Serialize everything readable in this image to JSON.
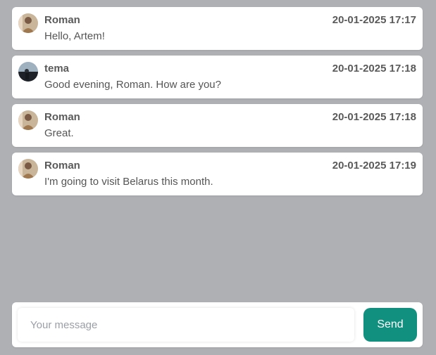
{
  "colors": {
    "background": "#aeb0b4",
    "card": "#ffffff",
    "send_button": "#12907f"
  },
  "messages": [
    {
      "author": "Roman",
      "time": "20-01-2025 17:17",
      "text": "Hello, Artem!",
      "avatar_icon": "user-avatar-icon"
    },
    {
      "author": "tema",
      "time": "20-01-2025 17:18",
      "text": "Good evening, Roman. How are you?",
      "avatar_icon": "user-avatar-icon"
    },
    {
      "author": "Roman",
      "time": "20-01-2025 17:18",
      "text": "Great.",
      "avatar_icon": "user-avatar-icon"
    },
    {
      "author": "Roman",
      "time": "20-01-2025 17:19",
      "text": "I'm going to visit Belarus this month.",
      "avatar_icon": "user-avatar-icon"
    }
  ],
  "composer": {
    "placeholder": "Your message",
    "value": "",
    "send_label": "Send"
  }
}
